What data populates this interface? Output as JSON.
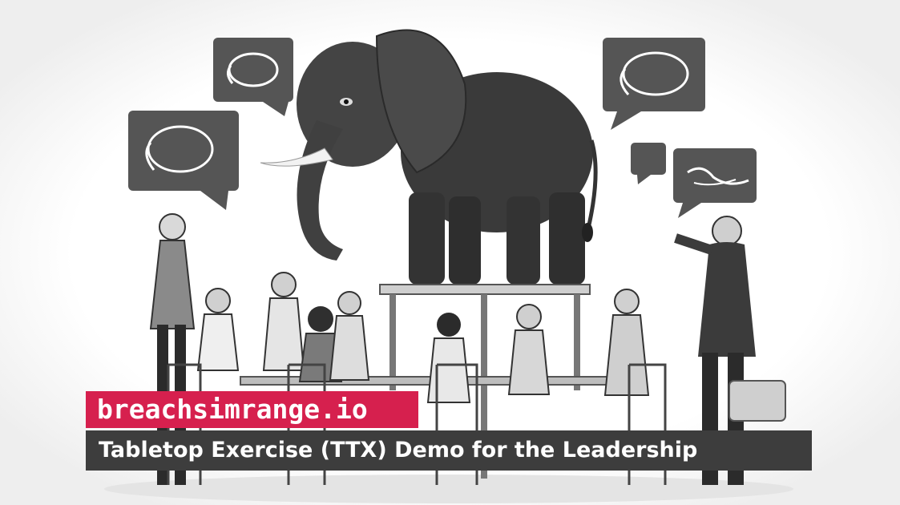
{
  "brand": {
    "site_label": "breachsimrange.io"
  },
  "banner": {
    "title": "Tabletop Exercise (TTX) Demo for the Leadership"
  },
  "illustration": {
    "subject": "elephant-in-the-room",
    "palette": {
      "background": "#ffffff",
      "ink": "#2b2b2b",
      "bubble": "#555555",
      "accent": "#d6204e",
      "banner": "#3d3d3d"
    }
  }
}
